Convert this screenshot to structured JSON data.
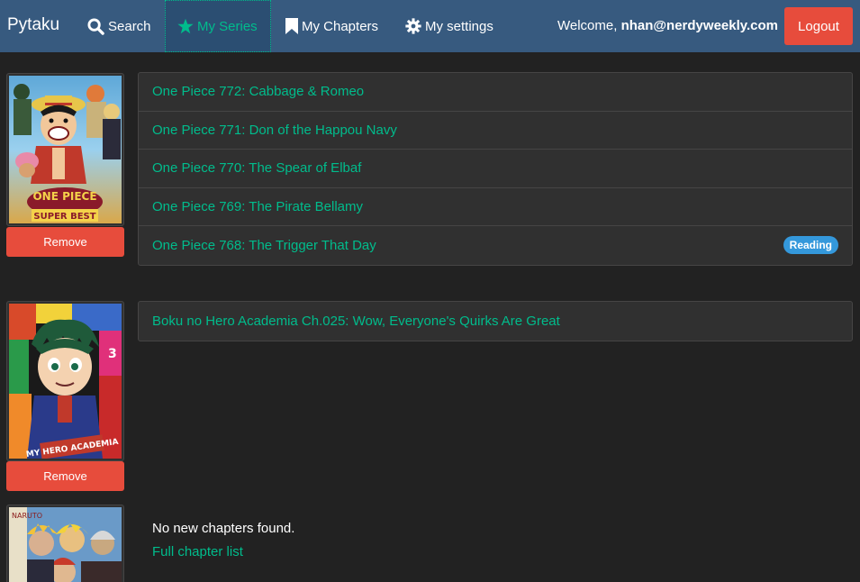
{
  "navbar": {
    "brand": "Pytaku",
    "items": [
      {
        "label": "Search",
        "icon": "search-icon"
      },
      {
        "label": "My Series",
        "icon": "star-icon"
      },
      {
        "label": "My Chapters",
        "icon": "bookmark-icon"
      },
      {
        "label": "My settings",
        "icon": "gear-icon"
      }
    ],
    "welcome_prefix": "Welcome,",
    "user_email": "nhan@nerdyweekly.com",
    "logout_label": "Logout"
  },
  "series": [
    {
      "cover": "one-piece-cover",
      "remove_label": "Remove",
      "chapters": [
        {
          "title": "One Piece 772: Cabbage & Romeo",
          "badge": ""
        },
        {
          "title": "One Piece 771: Don of the Happou Navy",
          "badge": ""
        },
        {
          "title": "One Piece 770: The Spear of Elbaf",
          "badge": ""
        },
        {
          "title": "One Piece 769: The Pirate Bellamy",
          "badge": ""
        },
        {
          "title": "One Piece 768: The Trigger That Day",
          "badge": "Reading"
        }
      ]
    },
    {
      "cover": "boku-no-hero-cover",
      "remove_label": "Remove",
      "chapters": [
        {
          "title": "Boku no Hero Academia Ch.025: Wow, Everyone's Quirks Are Great",
          "badge": ""
        }
      ]
    },
    {
      "cover": "naruto-cover",
      "empty_message": "No new chapters found.",
      "full_list_label": "Full chapter list"
    }
  ],
  "colors": {
    "navbar": "#375a7f",
    "background": "#222222",
    "accent": "#00bc8c",
    "danger": "#e74c3c",
    "info": "#3498db"
  }
}
